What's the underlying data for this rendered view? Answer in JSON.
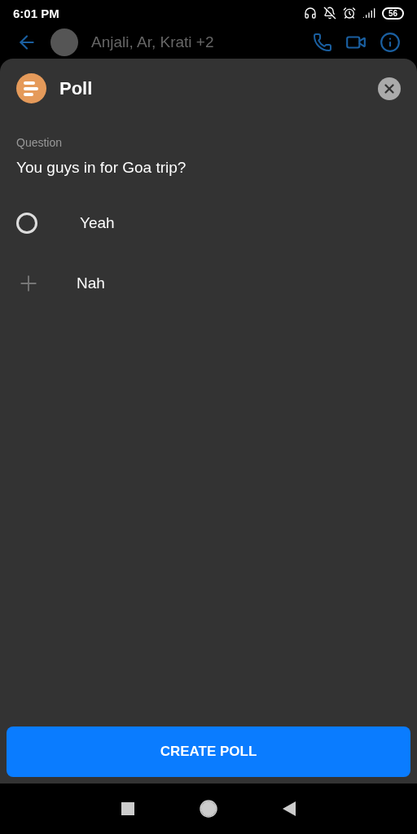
{
  "status_bar": {
    "time": "6:01 PM",
    "battery": "56"
  },
  "chat_header": {
    "title": "Anjali, Ar, Krati +2"
  },
  "sheet": {
    "title": "Poll",
    "question_label": "Question",
    "question": "You guys in for Goa trip?",
    "options": [
      {
        "kind": "radio",
        "label": "Yeah",
        "selected": false
      },
      {
        "kind": "add",
        "label": "Nah"
      }
    ],
    "button": "CREATE POLL"
  }
}
